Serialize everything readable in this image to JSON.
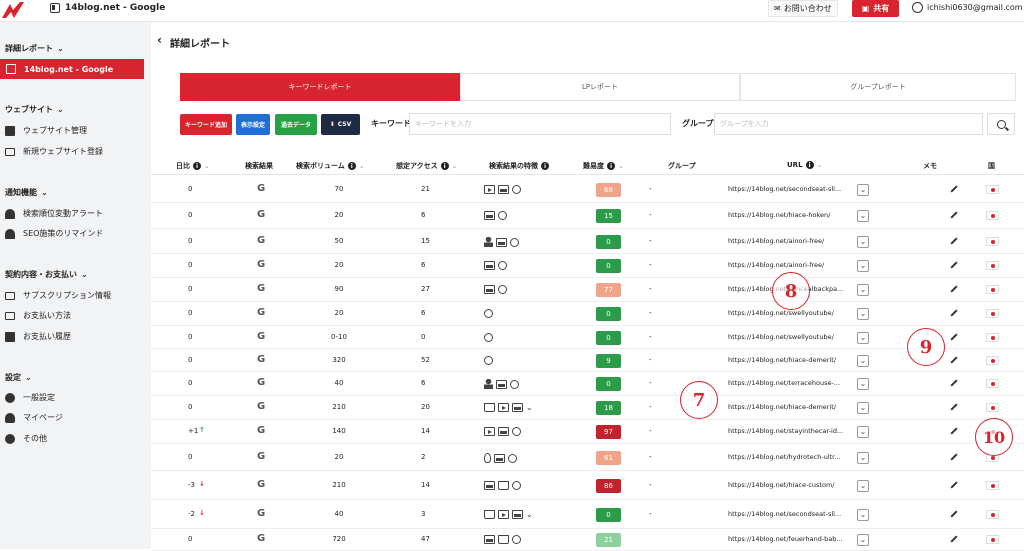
{
  "header": {
    "site_title": "14blog.net - Google",
    "contact_label": "お問い合わせ",
    "share_label": "共有",
    "user_email": "ichishi0630@gmail.com"
  },
  "sidebar": {
    "sections": [
      {
        "title": "詳細レポート",
        "items": [
          {
            "label": "14blog.net - Google",
            "active": true,
            "icon": "building-icon"
          }
        ]
      },
      {
        "title": "ウェブサイト",
        "items": [
          {
            "label": "ウェブサイト管理",
            "icon": "grid-icon"
          },
          {
            "label": "新規ウェブサイト登録",
            "icon": "add-site-icon"
          }
        ]
      },
      {
        "title": "通知機能",
        "items": [
          {
            "label": "検索順位変動アラート",
            "icon": "bell-icon"
          },
          {
            "label": "SEO施策のリマインド",
            "icon": "bell-icon"
          }
        ]
      },
      {
        "title": "契約内容・お支払い",
        "items": [
          {
            "label": "サブスクリプション情報",
            "icon": "card-icon"
          },
          {
            "label": "お支払い方法",
            "icon": "card-icon"
          },
          {
            "label": "お支払い履歴",
            "icon": "list-icon"
          }
        ]
      },
      {
        "title": "設定",
        "items": [
          {
            "label": "一般設定",
            "icon": "gear-icon"
          },
          {
            "label": "マイページ",
            "icon": "person-icon"
          },
          {
            "label": "その他",
            "icon": "gear-icon"
          }
        ]
      }
    ]
  },
  "main": {
    "page_title": "詳細レポート",
    "tabs": [
      {
        "label": "キーワードレポート",
        "active": true
      },
      {
        "label": "LPレポート"
      },
      {
        "label": "グループレポート"
      }
    ],
    "toolbar": {
      "add_keyword": "キーワード追加",
      "display_settings": "表示設定",
      "past_data": "過去データ",
      "csv": "CSV",
      "keyword_label": "キーワード",
      "keyword_placeholder": "キーワードを入力",
      "group_label": "グループ",
      "group_placeholder": "グループを入力"
    },
    "table": {
      "headers": {
        "change": "日比",
        "engine": "検索結果",
        "volume": "検索ボリューム",
        "access": "想定アクセス",
        "features": "検索結果の特徴",
        "difficulty": "難易度",
        "group": "グループ",
        "url": "URL",
        "memo": "メモ",
        "country": "国"
      },
      "rows": [
        {
          "change": "0",
          "volume": "70",
          "access": "21",
          "features": [
            "video",
            "image",
            "search"
          ],
          "difficulty": "68",
          "diff_color": "#f0a48a",
          "group": "-",
          "url": "https://14blog.net/secondseat-sli..."
        },
        {
          "change": "0",
          "volume": "20",
          "access": "6",
          "features": [
            "image",
            "search"
          ],
          "difficulty": "15",
          "diff_color": "#2d9c4a",
          "group": "-",
          "url": "https://14blog.net/hiace-hoken/"
        },
        {
          "change": "0",
          "volume": "50",
          "access": "15",
          "features": [
            "person",
            "image",
            "search"
          ],
          "difficulty": "0",
          "diff_color": "#2d9c4a",
          "group": "-",
          "url": "https://14blog.net/ainori-free/"
        },
        {
          "change": "0",
          "volume": "20",
          "access": "6",
          "features": [
            "image",
            "search"
          ],
          "difficulty": "0",
          "diff_color": "#2d9c4a",
          "group": "-",
          "url": "https://14blog.net/ainori-free/"
        },
        {
          "change": "0",
          "volume": "90",
          "access": "27",
          "features": [
            "image",
            "search"
          ],
          "difficulty": "77",
          "diff_color": "#f0a48a",
          "group": "-",
          "url": "https://14blog.net/concealbackpa..."
        },
        {
          "change": "0",
          "volume": "20",
          "access": "6",
          "features": [
            "search"
          ],
          "difficulty": "0",
          "diff_color": "#2d9c4a",
          "group": "-",
          "url": "https://14blog.net/swellyoutube/"
        },
        {
          "change": "0",
          "volume": "0-10",
          "access": "0",
          "features": [
            "search"
          ],
          "difficulty": "0",
          "diff_color": "#2d9c4a",
          "group": "-",
          "url": "https://14blog.net/swellyoutube/"
        },
        {
          "change": "0",
          "volume": "320",
          "access": "52",
          "features": [
            "search"
          ],
          "difficulty": "9",
          "diff_color": "#2d9c4a",
          "group": "-",
          "url": "https://14blog.net/hiace-demerit/"
        },
        {
          "change": "0",
          "volume": "40",
          "access": "6",
          "features": [
            "person",
            "image",
            "search"
          ],
          "difficulty": "0",
          "diff_color": "#2d9c4a",
          "group": "-",
          "url": "https://14blog.net/terracehouse-..."
        },
        {
          "change": "0",
          "volume": "210",
          "access": "20",
          "features": [
            "cart",
            "video",
            "image",
            "chev"
          ],
          "difficulty": "18",
          "diff_color": "#2d9c4a",
          "group": "-",
          "url": "https://14blog.net/hiace-demerit/"
        },
        {
          "change": "+1",
          "trend": "up",
          "volume": "140",
          "access": "14",
          "features": [
            "video",
            "image",
            "search"
          ],
          "difficulty": "97",
          "diff_color": "#c0232c",
          "group": "-",
          "url": "https://14blog.net/stayinthecar-id..."
        },
        {
          "change": "0",
          "volume": "20",
          "access": "2",
          "features": [
            "pin",
            "image",
            "search"
          ],
          "difficulty": "61",
          "diff_color": "#f0a48a",
          "group": "-",
          "url": "https://14blog.net/hydrotech-ultr..."
        },
        {
          "change": "-3",
          "trend": "down",
          "volume": "210",
          "access": "14",
          "features": [
            "image",
            "cart",
            "search"
          ],
          "difficulty": "86",
          "diff_color": "#c0232c",
          "group": "-",
          "url": "https://14blog.net/hiace-custom/"
        },
        {
          "change": "-2",
          "trend": "down",
          "volume": "40",
          "access": "3",
          "features": [
            "cart",
            "video",
            "image",
            "chev"
          ],
          "difficulty": "0",
          "diff_color": "#2d9c4a",
          "group": "-",
          "url": "https://14blog.net/secondseat-sli..."
        },
        {
          "change": "0",
          "volume": "720",
          "access": "47",
          "features": [
            "image",
            "cart",
            "search"
          ],
          "difficulty": "21",
          "diff_color": "#8fd19e",
          "group": "",
          "url": "https://14blog.net/feuerhand-bab..."
        }
      ]
    }
  },
  "annotations": [
    "7",
    "8",
    "9",
    "10"
  ]
}
